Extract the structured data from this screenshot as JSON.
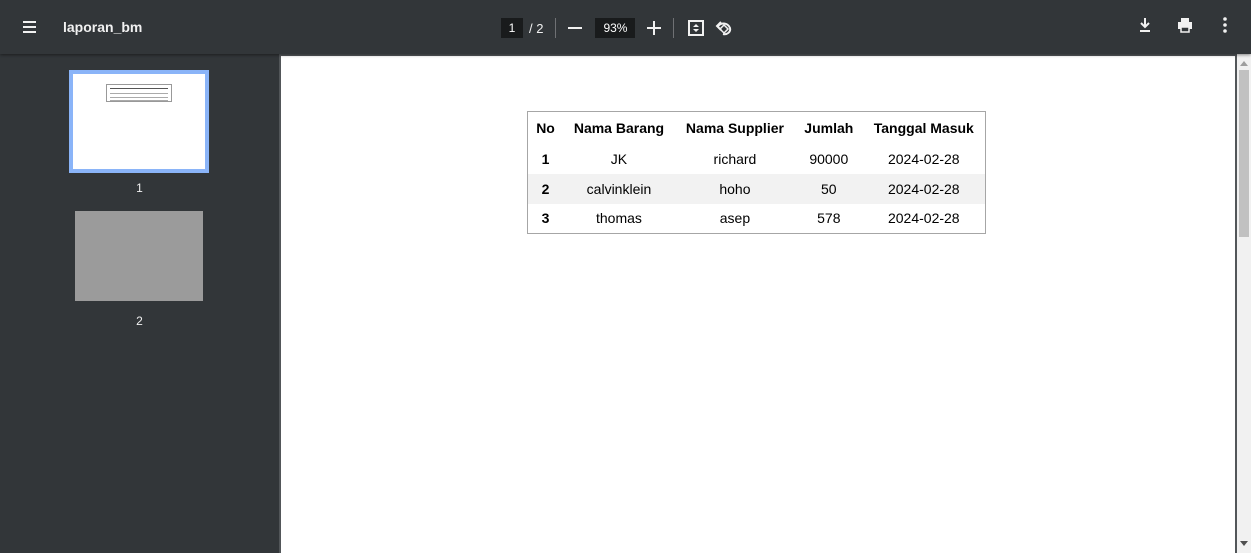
{
  "toolbar": {
    "title": "laporan_bm",
    "current_page": "1",
    "page_total": "/ 2",
    "zoom": "93%"
  },
  "icons": {
    "menu": "hamburger-menu-icon",
    "fit": "fit-page-icon",
    "rotate": "rotate-counterclockwise-icon",
    "download": "download-icon",
    "print": "printer-icon",
    "more": "more-vertical-icon"
  },
  "sidebar": {
    "thumbnails": [
      {
        "label": "1"
      },
      {
        "label": "2"
      }
    ]
  },
  "table": {
    "headers": [
      "No",
      "Nama Barang",
      "Nama Supplier",
      "Jumlah",
      "Tanggal Masuk"
    ],
    "rows": [
      [
        "1",
        "JK",
        "richard",
        "90000",
        "2024-02-28"
      ],
      [
        "2",
        "calvinklein",
        "hoho",
        "50",
        "2024-02-28"
      ],
      [
        "3",
        "thomas",
        "asep",
        "578",
        "2024-02-28"
      ]
    ]
  },
  "colors": {
    "toolbar": "#323639",
    "viewer_background": "#525659",
    "selected_thumbnail_border": "#8ab4f8"
  }
}
